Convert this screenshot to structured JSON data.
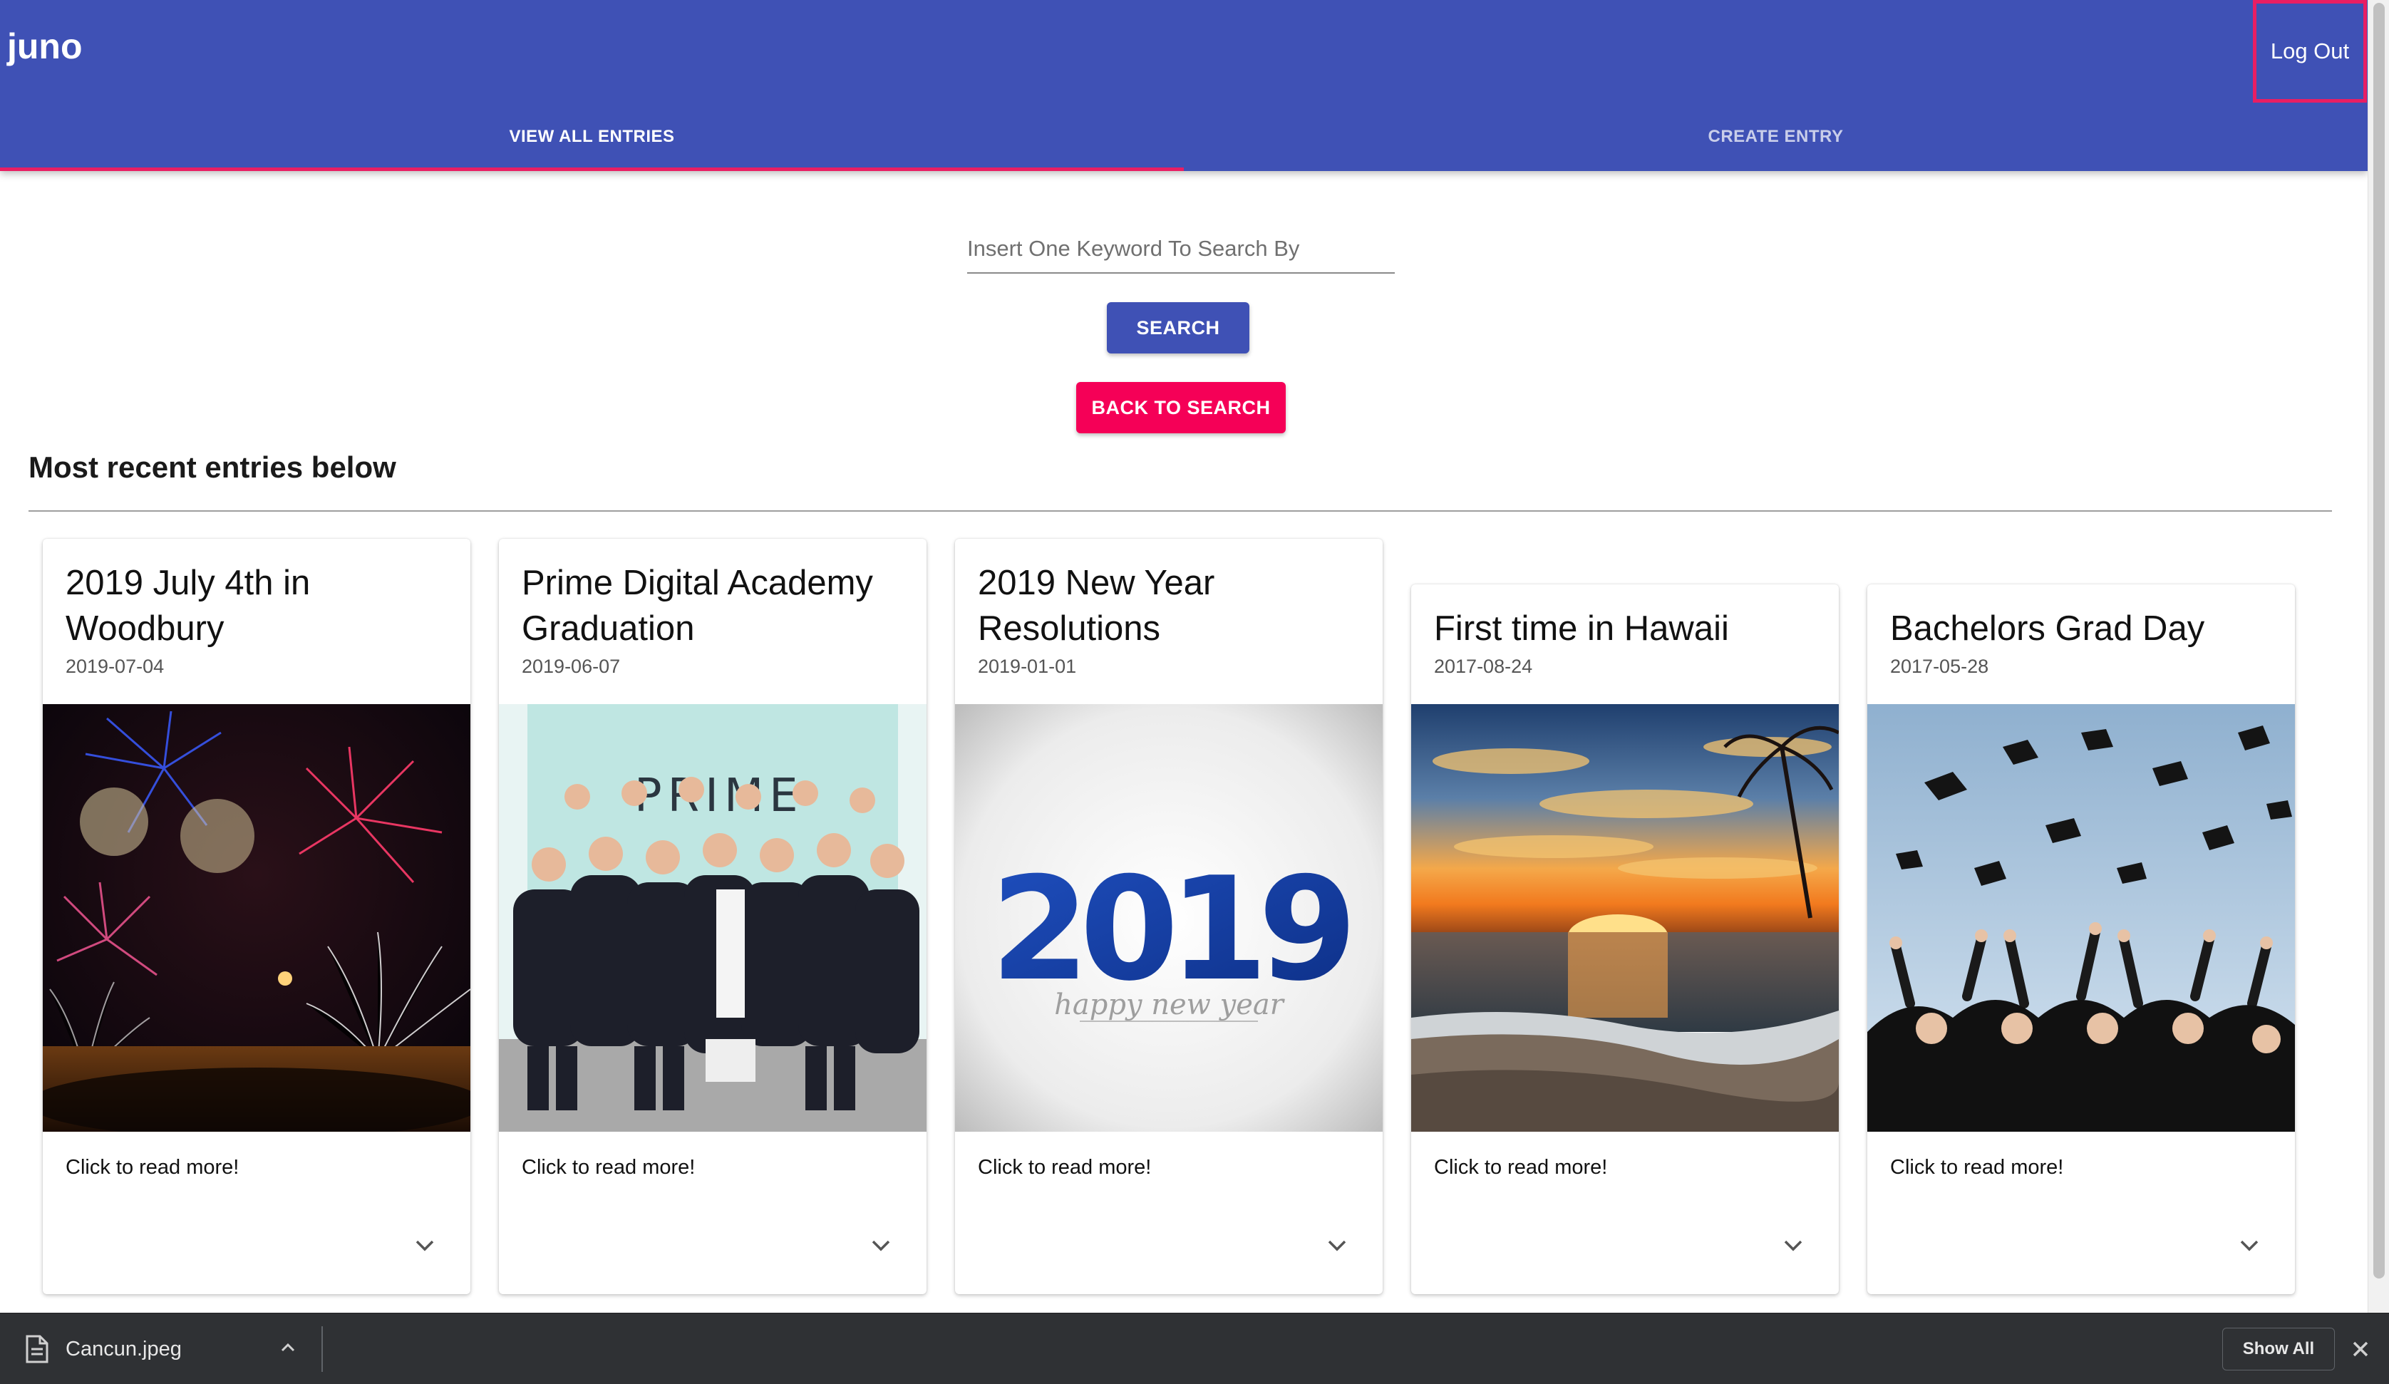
{
  "app": {
    "logo": "juno",
    "logout_label": "Log Out"
  },
  "tabs": [
    {
      "label": "VIEW ALL ENTRIES",
      "active": true
    },
    {
      "label": "CREATE ENTRY",
      "active": false
    }
  ],
  "search": {
    "placeholder": "Insert One Keyword To Search By",
    "value": "",
    "search_label": "SEARCH",
    "back_label": "BACK TO SEARCH"
  },
  "section": {
    "title": "Most recent entries below"
  },
  "entries": [
    {
      "title": "2019 July 4th in Woodbury",
      "date": "2019-07-04",
      "excerpt": "Click to read more!",
      "image": "fireworks-photo"
    },
    {
      "title": "Prime Digital Academy Graduation",
      "date": "2019-06-07",
      "excerpt": "Click to read more!",
      "image": "group-photo",
      "sign_text": "PRIME"
    },
    {
      "title": "2019 New Year Resolutions",
      "date": "2019-01-01",
      "excerpt": "Click to read more!",
      "image": "new-year-graphic",
      "graphic_year": "2019",
      "graphic_caption": "happy new year"
    },
    {
      "title": "First time in Hawaii",
      "date": "2017-08-24",
      "excerpt": "Click to read more!",
      "image": "sunset-beach-photo"
    },
    {
      "title": "Bachelors Grad Day",
      "date": "2017-05-28",
      "excerpt": "Click to read more!",
      "image": "graduation-caps-photo"
    }
  ],
  "downloads": {
    "file_name": "Cancun.jpeg",
    "show_all_label": "Show All"
  },
  "colors": {
    "primary": "#3f51b5",
    "accent": "#f50057",
    "indicator": "#e91e63",
    "download_bar": "#2f3134"
  }
}
